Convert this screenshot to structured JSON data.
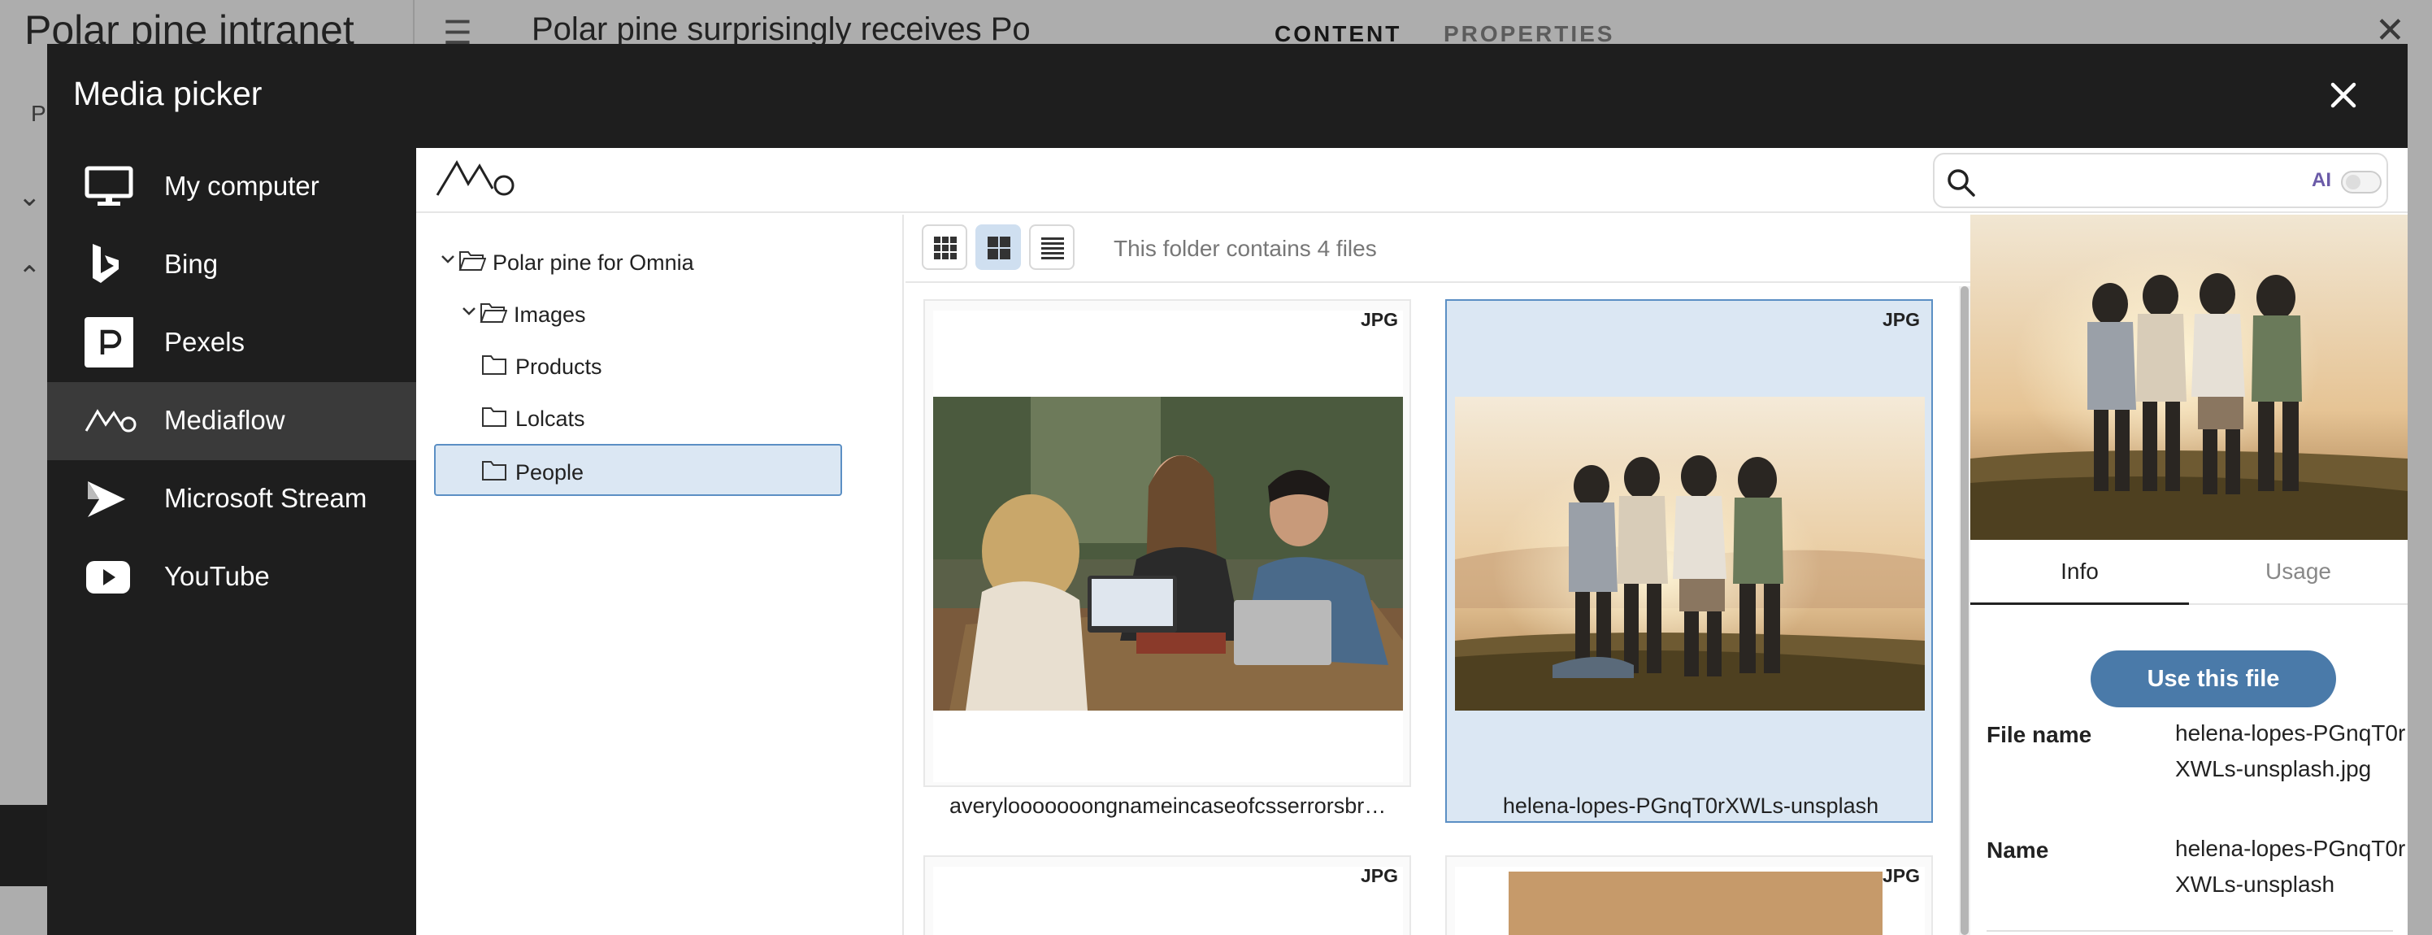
{
  "background_app": {
    "site_title": "Polar pine intranet",
    "left_letter": "P",
    "document_title": "Polar pine surprisingly receives Po",
    "tabs": {
      "content": "CONTENT",
      "properties": "PROPERTIES"
    }
  },
  "dialog": {
    "title": "Media picker",
    "sources": [
      {
        "label": "My computer",
        "icon": "monitor-icon"
      },
      {
        "label": "Bing",
        "icon": "bing-icon"
      },
      {
        "label": "Pexels",
        "icon": "pexels-icon"
      },
      {
        "label": "Mediaflow",
        "icon": "mediaflow-icon",
        "active": true
      },
      {
        "label": "Microsoft Stream",
        "icon": "stream-icon"
      },
      {
        "label": "YouTube",
        "icon": "youtube-icon"
      }
    ]
  },
  "search": {
    "placeholder": "",
    "ai_label": "AI",
    "ai_enabled": false
  },
  "tree": {
    "root": "Polar pine for Omnia",
    "images": "Images",
    "children": [
      "Products",
      "Lolcats",
      "People"
    ],
    "selected": "People"
  },
  "toolbar": {
    "view_modes": [
      "small-grid",
      "large-grid",
      "list"
    ],
    "active_view": "large-grid",
    "folder_info": "This folder contains 4 files"
  },
  "files": [
    {
      "name": "averylooooooongnameincaseofcsserrorsbr…",
      "type": "JPG",
      "selected": false
    },
    {
      "name": "helena-lopes-PGnqT0rXWLs-unsplash",
      "type": "JPG",
      "selected": true
    },
    {
      "name": "",
      "type": "JPG",
      "selected": false
    },
    {
      "name": "",
      "type": "JPG",
      "selected": false
    }
  ],
  "details": {
    "tabs": [
      "Info",
      "Usage"
    ],
    "active_tab": "Info",
    "use_button": "Use this file",
    "file_name_label": "File name",
    "file_name_value": "helena-lopes-PGnqT0rXWLs-unsplash.jpg",
    "name_label": "Name",
    "name_value": "helena-lopes-PGnqT0rXWLs-unsplash"
  },
  "colors": {
    "accent": "#4a7aa9",
    "selection": "#dbe7f3",
    "dark": "#1e1e1e"
  }
}
